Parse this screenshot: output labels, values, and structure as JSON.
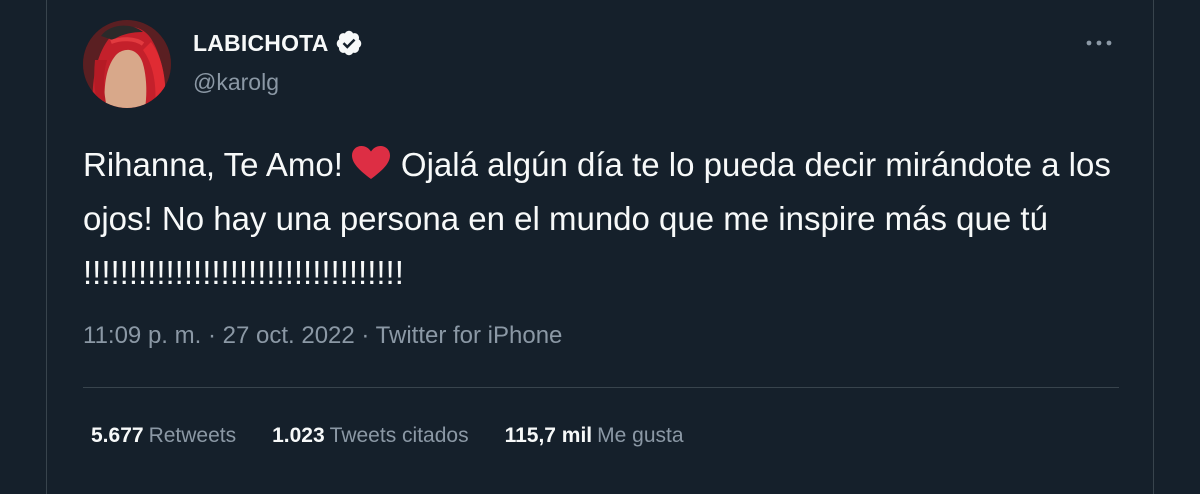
{
  "author": {
    "display_name": "LABICHOTA",
    "handle": "@karolg",
    "verified": true,
    "avatar_icon": "profile-photo-red-hair"
  },
  "tweet": {
    "text_part1": "Rihanna, Te Amo!",
    "emoji": "red-heart",
    "text_part2": "Ojalá algún día te lo pueda decir mirándote a los ojos! No hay una persona en el mundo que me inspire más que tú !!!!!!!!!!!!!!!!!!!!!!!!!!!!!!!!!!!"
  },
  "meta": {
    "time": "11:09 p. m.",
    "separator": "·",
    "date": "27 oct. 2022",
    "source": "Twitter for iPhone"
  },
  "stats": [
    {
      "value": "5.677",
      "label": "Retweets"
    },
    {
      "value": "1.023",
      "label": "Tweets citados"
    },
    {
      "value": "115,7 mil",
      "label": "Me gusta"
    }
  ],
  "colors": {
    "background": "#15202b",
    "text": "#f7f9f9",
    "secondary": "#8b98a5",
    "border": "#38444d",
    "heart": "#dd2e44"
  },
  "icons": {
    "more": "more-dots-icon",
    "verified": "verified-badge-icon"
  }
}
